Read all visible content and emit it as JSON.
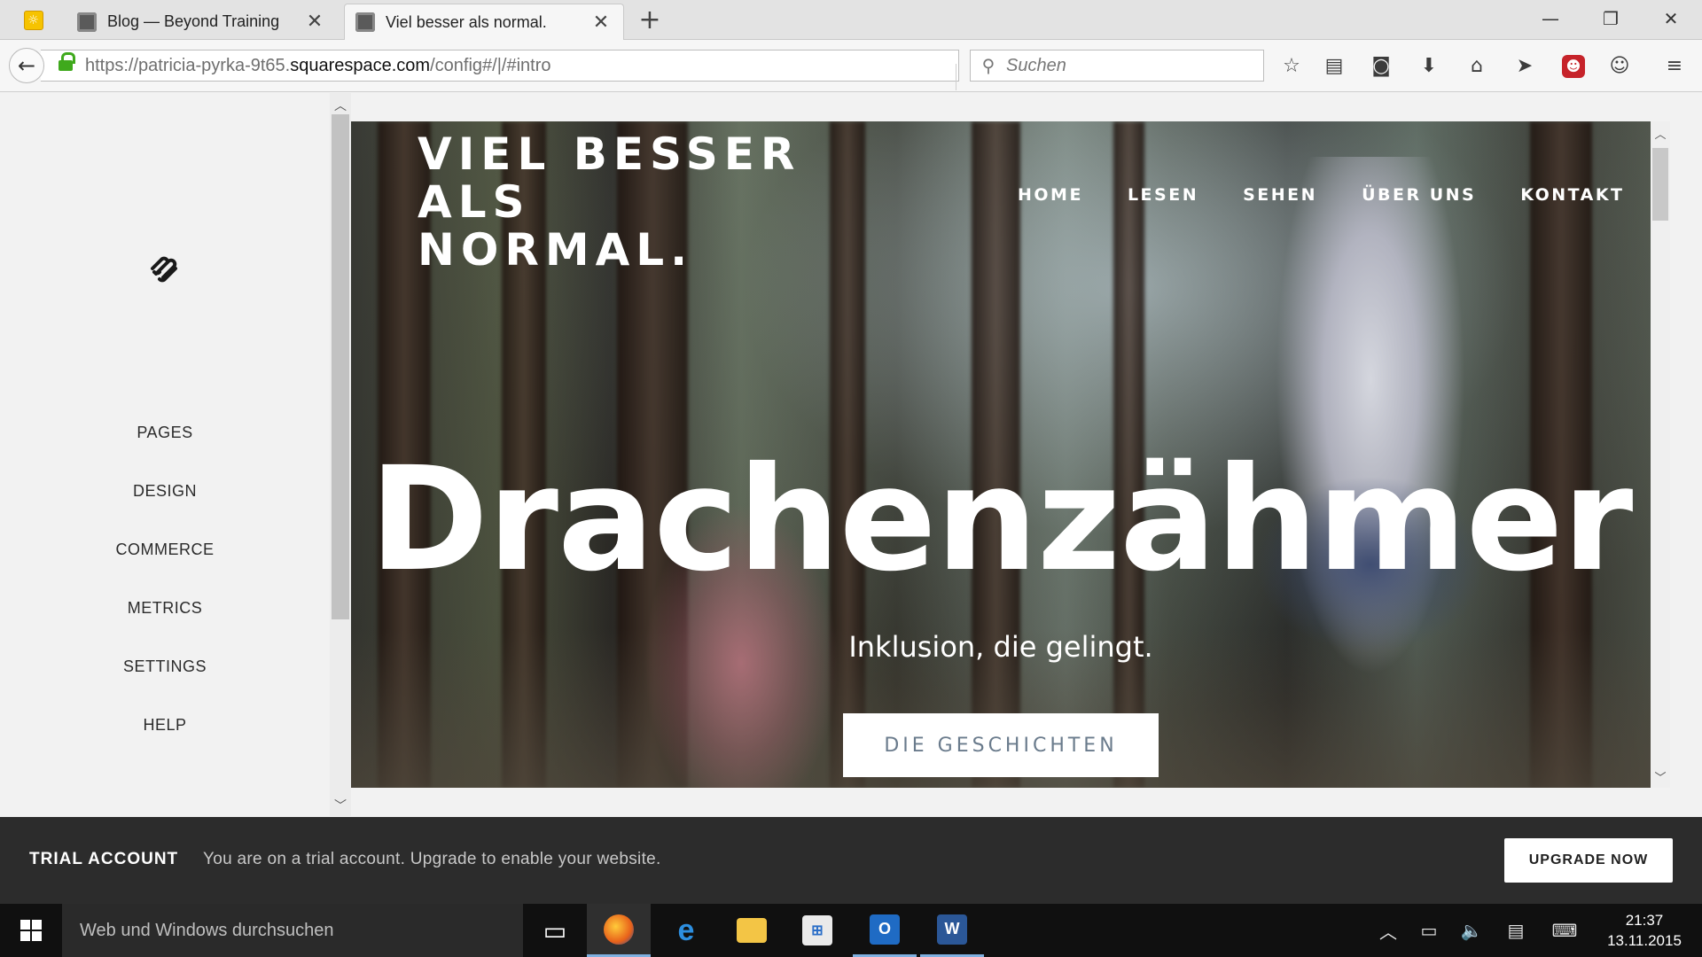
{
  "browser": {
    "tabs": [
      {
        "label": "Blog — Beyond Training",
        "active": false
      },
      {
        "label": "Viel besser als normal.",
        "active": true
      }
    ],
    "new_tab": "+",
    "window_controls": {
      "minimize": "—",
      "restore": "❐",
      "close": "✕"
    },
    "url": {
      "prefix": "https://patricia-pyrka-9t65.",
      "host": "squarespace.com",
      "path": "/config#/|/#intro"
    },
    "search_placeholder": "Suchen",
    "toolbar_icons": [
      "bookmark-star-icon",
      "reading-list-icon",
      "pocket-icon",
      "download-icon",
      "home-icon",
      "send-icon",
      "addon-monster-icon",
      "chat-icon",
      "menu-icon"
    ]
  },
  "sidebar": {
    "items": [
      "PAGES",
      "DESIGN",
      "COMMERCE",
      "METRICS",
      "SETTINGS",
      "HELP"
    ]
  },
  "site": {
    "title": "VIEL BESSER\nALS\nNORMAL.",
    "nav": [
      "HOME",
      "LESEN",
      "SEHEN",
      "ÜBER UNS",
      "KONTAKT"
    ],
    "hero_title": "Drachenzähmer",
    "hero_subtitle": "Inklusion, die gelingt.",
    "hero_button": "DIE GESCHICHTEN"
  },
  "trial": {
    "label": "TRIAL ACCOUNT",
    "message": "You are on a trial account. Upgrade to enable your website.",
    "button": "UPGRADE NOW"
  },
  "taskbar": {
    "search_placeholder": "Web und Windows durchsuchen",
    "apps": [
      "task-view",
      "firefox",
      "edge",
      "file-explorer",
      "store",
      "outlook",
      "word"
    ],
    "time": "21:37",
    "date": "13.11.2015"
  }
}
